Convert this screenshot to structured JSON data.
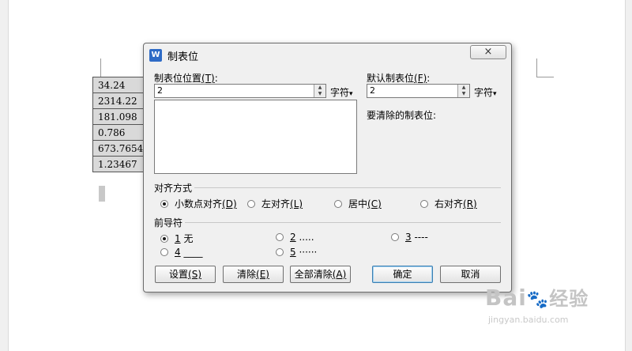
{
  "document": {
    "table_values": [
      "34.24",
      "2314.22",
      "181.098",
      "0.786",
      "673.7654",
      "1.23467"
    ]
  },
  "dialog": {
    "title": "制表位",
    "close_glyph": "×",
    "tab_position": {
      "label": "制表位位置",
      "mnemonic": "(T)",
      "value": "2",
      "unit": "字符",
      "unit_arrow": "▾"
    },
    "default_tab": {
      "label": "默认制表位",
      "mnemonic": "(F)",
      "value": "2",
      "unit": "字符",
      "unit_arrow": "▾"
    },
    "to_clear_label": "要清除的制表位:",
    "alignment": {
      "group_label": "对齐方式",
      "options": [
        {
          "text": "小数点对齐",
          "mnemonic": "(D)",
          "selected": true
        },
        {
          "text": "左对齐",
          "mnemonic": "(L)",
          "selected": false
        },
        {
          "text": "居中",
          "mnemonic": "(C)",
          "selected": false
        },
        {
          "text": "右对齐",
          "mnemonic": "(R)",
          "selected": false
        }
      ]
    },
    "leader": {
      "group_label": "前导符",
      "options": [
        {
          "num": "1",
          "text": "无",
          "selected": true
        },
        {
          "num": "2",
          "text": ".....",
          "selected": false
        },
        {
          "num": "3",
          "text": "----",
          "selected": false
        },
        {
          "num": "4",
          "text": "____",
          "selected": false
        },
        {
          "num": "5",
          "text": "······",
          "selected": false
        }
      ]
    },
    "buttons": {
      "set": "设置",
      "set_mnemonic": "(S)",
      "clear": "清除",
      "clear_mnemonic": "(E)",
      "clear_all": "全部清除",
      "clear_all_mnemonic": "(A)",
      "ok": "确定",
      "cancel": "取消"
    }
  },
  "watermark": {
    "logo": "Bai",
    "logo_paw": "🐾",
    "logo_suffix": "经验",
    "url": "jingyan.baidu.com"
  },
  "colors": {
    "table_cell": "#d9d9d9",
    "dialog_bg": "#f0f0f0",
    "app_icon": "#2e6bc6",
    "default_button_border": "#3c7fb1"
  }
}
